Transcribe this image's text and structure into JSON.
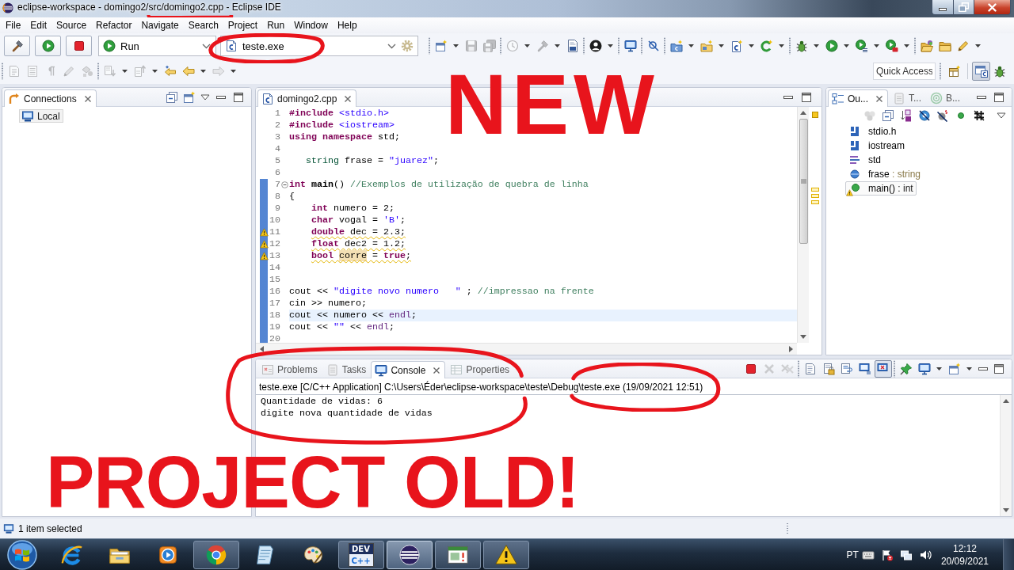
{
  "window": {
    "title": "eclipse-workspace - domingo2/src/domingo2.cpp - Eclipse IDE"
  },
  "menu": [
    "File",
    "Edit",
    "Source",
    "Refactor",
    "Navigate",
    "Search",
    "Project",
    "Run",
    "Window",
    "Help"
  ],
  "toolbar": {
    "launch_buttons": [
      {
        "kind": "build"
      },
      {
        "kind": "launch"
      },
      {
        "kind": "stop"
      }
    ],
    "launch_mode": {
      "value": "Run"
    },
    "launch_config": {
      "value": "teste.exe"
    },
    "items": [
      {
        "kind": "separator"
      },
      {
        "kind": "new",
        "disabled": false
      },
      {
        "kind": "dropdown"
      },
      {
        "kind": "save",
        "disabled": true
      },
      {
        "kind": "saveall",
        "disabled": true
      },
      {
        "kind": "separator"
      },
      {
        "kind": "clock",
        "disabled": true
      },
      {
        "kind": "dropdown"
      },
      {
        "kind": "hammer",
        "disabled": true
      },
      {
        "kind": "dropdown"
      },
      {
        "kind": "binary",
        "disabled": false
      },
      {
        "kind": "separator"
      },
      {
        "kind": "person",
        "disabled": false
      },
      {
        "kind": "dropdown"
      },
      {
        "kind": "separator"
      },
      {
        "kind": "monitor",
        "disabled": false
      },
      {
        "kind": "separator"
      },
      {
        "kind": "pin",
        "disabled": false
      },
      {
        "kind": "separator"
      },
      {
        "kind": "newproj",
        "disabled": false
      },
      {
        "kind": "dropdown"
      },
      {
        "kind": "newfolder",
        "disabled": false
      },
      {
        "kind": "dropdown"
      },
      {
        "kind": "newfile",
        "disabled": false
      },
      {
        "kind": "dropdown"
      },
      {
        "kind": "newclass",
        "disabled": false
      },
      {
        "kind": "dropdown"
      },
      {
        "kind": "separator"
      },
      {
        "kind": "bug",
        "disabled": false
      },
      {
        "kind": "dropdown"
      },
      {
        "kind": "play",
        "disabled": false
      },
      {
        "kind": "dropdown"
      },
      {
        "kind": "playlist",
        "disabled": false
      },
      {
        "kind": "dropdown"
      },
      {
        "kind": "playbox",
        "disabled": false
      },
      {
        "kind": "dropdown"
      },
      {
        "kind": "separator"
      },
      {
        "kind": "openfolder",
        "disabled": false
      },
      {
        "kind": "folder",
        "disabled": false
      },
      {
        "kind": "pen",
        "disabled": false
      },
      {
        "kind": "dropdown"
      }
    ]
  },
  "toolbar2": {
    "items": [
      {
        "kind": "separator"
      },
      {
        "kind": "toggle",
        "disabled": true
      },
      {
        "kind": "list",
        "disabled": true
      },
      {
        "kind": "pilcrow",
        "disabled": true
      },
      {
        "kind": "pen",
        "disabled": true
      },
      {
        "kind": "shapes",
        "disabled": true
      },
      {
        "kind": "separator"
      },
      {
        "kind": "nextann",
        "disabled": true
      },
      {
        "kind": "dropdown"
      },
      {
        "kind": "prevann",
        "disabled": true
      },
      {
        "kind": "dropdown"
      },
      {
        "kind": "lastedit",
        "disabled": false
      },
      {
        "kind": "back",
        "disabled": false
      },
      {
        "kind": "dropdown"
      },
      {
        "kind": "forward",
        "disabled": true
      },
      {
        "kind": "dropdown"
      }
    ],
    "quick_access": {
      "placeholder": "Quick Access"
    },
    "perspectives": [
      {
        "kind": "open",
        "selected": false
      },
      {
        "kind": "cpp",
        "selected": true
      },
      {
        "kind": "debug",
        "selected": false
      }
    ]
  },
  "connections": {
    "tab": {
      "label": "Connections"
    },
    "items": [
      {
        "label": "Local",
        "selected": true
      }
    ]
  },
  "editor": {
    "tab": {
      "label": "domingo2.cpp"
    },
    "sections": [
      {
        "in_range": false,
        "lines": [
          {
            "number": "1",
            "tokens": [
              {
                "text": "#include",
                "kind": "keyword"
              },
              {
                "text": " <stdio.h>",
                "kind": "string"
              }
            ],
            "warning": false,
            "current": false,
            "foldable": false
          },
          {
            "number": "2",
            "tokens": [
              {
                "text": "#include",
                "kind": "keyword"
              },
              {
                "text": " <iostream>",
                "kind": "string"
              }
            ],
            "warning": false,
            "current": false,
            "foldable": false
          },
          {
            "number": "3",
            "tokens": [
              {
                "text": "using",
                "kind": "keyword"
              },
              {
                "text": " namespace",
                "kind": "keyword"
              },
              {
                "text": " std;",
                "kind": "plain"
              }
            ],
            "warning": false,
            "current": false,
            "foldable": false
          },
          {
            "number": "4",
            "warning": false,
            "current": false,
            "foldable": false
          },
          {
            "number": "5",
            "tokens": [
              {
                "text": "   string",
                "kind": "type"
              },
              {
                "text": " frase = ",
                "kind": "plain"
              },
              {
                "text": "\"juarez\"",
                "kind": "string"
              },
              {
                "text": ";",
                "kind": "plain"
              }
            ],
            "warning": false,
            "current": false,
            "foldable": false
          },
          {
            "number": "6",
            "warning": false,
            "current": false,
            "foldable": false
          }
        ]
      },
      {
        "in_range": true,
        "lines": [
          {
            "number": "7",
            "tokens": [
              {
                "text": "int",
                "kind": "keyword"
              },
              {
                "text": " main",
                "kind": "function"
              },
              {
                "text": "() ",
                "kind": "plain"
              },
              {
                "text": "//Exemplos de utilização de quebra de linha",
                "kind": "comment"
              }
            ],
            "warning": false,
            "current": false,
            "foldable": true
          },
          {
            "number": "8",
            "tokens": [
              {
                "text": "{",
                "kind": "plain"
              }
            ],
            "warning": false,
            "current": false,
            "foldable": false
          },
          {
            "number": "9",
            "tokens": [
              {
                "text": "    int",
                "kind": "keyword"
              },
              {
                "text": " numero = 2;",
                "kind": "plain"
              }
            ],
            "warning": false,
            "current": false,
            "foldable": false
          },
          {
            "number": "10",
            "tokens": [
              {
                "text": "    char",
                "kind": "keyword"
              },
              {
                "text": " vogal = ",
                "kind": "plain"
              },
              {
                "text": "'B'",
                "kind": "string"
              },
              {
                "text": ";",
                "kind": "plain"
              }
            ],
            "warning": false,
            "current": false,
            "foldable": false
          },
          {
            "number": "11",
            "tokens": [
              {
                "text": "    double",
                "kind": "keyword"
              },
              {
                "text": " dec = 2.3;",
                "kind": "plain"
              }
            ],
            "warning": true,
            "current": false,
            "foldable": false
          },
          {
            "number": "12",
            "tokens": [
              {
                "text": "    float",
                "kind": "keyword"
              },
              {
                "text": " dec2 = 1.2;",
                "kind": "plain"
              }
            ],
            "warning": true,
            "current": false,
            "foldable": false
          },
          {
            "number": "13",
            "tokens": [
              {
                "text": "    bool ",
                "kind": "keyword"
              },
              {
                "text": "corre",
                "kind": "occurrence"
              },
              {
                "text": " = ",
                "kind": "plain"
              },
              {
                "text": "true",
                "kind": "keyword"
              },
              {
                "text": ";",
                "kind": "plain"
              }
            ],
            "warning": true,
            "current": false,
            "foldable": false
          },
          {
            "number": "14",
            "warning": false,
            "current": false,
            "foldable": false
          },
          {
            "number": "15",
            "warning": false,
            "current": false,
            "foldable": false
          },
          {
            "number": "16",
            "tokens": [
              {
                "text": "cout << ",
                "kind": "plain"
              },
              {
                "text": "\"digite novo numero   \"",
                "kind": "string"
              },
              {
                "text": " ; ",
                "kind": "plain"
              },
              {
                "text": "//impressao na frente",
                "kind": "comment"
              }
            ],
            "warning": false,
            "current": false,
            "foldable": false
          },
          {
            "number": "17",
            "tokens": [
              {
                "text": "cin >> numero;",
                "kind": "plain"
              }
            ],
            "warning": false,
            "current": false,
            "foldable": false
          },
          {
            "number": "18",
            "tokens": [
              {
                "text": "cout << numero << ",
                "kind": "plain"
              },
              {
                "text": "endl",
                "kind": "library"
              },
              {
                "text": ";",
                "kind": "plain"
              }
            ],
            "warning": false,
            "current": true,
            "foldable": false
          },
          {
            "number": "19",
            "tokens": [
              {
                "text": "cout << ",
                "kind": "plain"
              },
              {
                "text": "\"\"",
                "kind": "string"
              },
              {
                "text": " << ",
                "kind": "plain"
              },
              {
                "text": "endl",
                "kind": "library"
              },
              {
                "text": ";",
                "kind": "plain"
              }
            ],
            "warning": false,
            "current": false,
            "foldable": false
          },
          {
            "number": "20",
            "warning": false,
            "current": false,
            "foldable": false
          }
        ]
      }
    ]
  },
  "outline": {
    "tabs": [
      {
        "kind": "outline",
        "label": "Ou...",
        "selected": true
      },
      {
        "kind": "tasks",
        "label": "T...",
        "selected": false
      },
      {
        "kind": "targets",
        "label": "B...",
        "selected": false
      }
    ],
    "actions": [
      {
        "kind": "circles",
        "disabled": true
      },
      {
        "kind": "collapse",
        "disabled": false
      },
      {
        "kind": "sortaz",
        "disabled": false
      },
      {
        "kind": "hidefields",
        "disabled": false
      },
      {
        "kind": "hidestatic",
        "disabled": false
      },
      {
        "kind": "dot",
        "disabled": false
      },
      {
        "kind": "hash",
        "disabled": false
      }
    ],
    "items": [
      {
        "kind": "include",
        "label": "stdio.h",
        "selected": false,
        "warning": false
      },
      {
        "kind": "include",
        "label": "iostream",
        "selected": false,
        "warning": false
      },
      {
        "kind": "namespace",
        "label": "std",
        "selected": false,
        "warning": false
      },
      {
        "kind": "variable",
        "label": "frase",
        "type": ": string",
        "selected": false,
        "warning": false
      },
      {
        "kind": "function",
        "label": "main()",
        "type": ": int",
        "selected": true,
        "warning": true
      }
    ]
  },
  "console": {
    "tabs": [
      {
        "kind": "problems",
        "label": "Problems",
        "selected": false
      },
      {
        "kind": "tasks",
        "label": "Tasks",
        "selected": false
      },
      {
        "kind": "console",
        "label": "Console",
        "selected": true
      },
      {
        "kind": "properties",
        "label": "Properties",
        "selected": false
      }
    ],
    "actions": [
      {
        "kind": "stop",
        "disabled": false,
        "on": false
      },
      {
        "kind": "remove",
        "disabled": true,
        "on": false
      },
      {
        "kind": "removeall",
        "disabled": true,
        "on": false
      },
      {
        "kind": "separator"
      },
      {
        "kind": "clear",
        "disabled": false,
        "on": false
      },
      {
        "kind": "lock",
        "disabled": false,
        "on": false
      },
      {
        "kind": "wrap",
        "disabled": false,
        "on": false
      },
      {
        "kind": "stdout",
        "disabled": false,
        "on": false
      },
      {
        "kind": "stderr",
        "disabled": false,
        "on": true
      },
      {
        "kind": "separator"
      },
      {
        "kind": "pinconsole",
        "disabled": false,
        "on": false
      },
      {
        "kind": "monitor",
        "disabled": false,
        "on": false
      },
      {
        "kind": "dropdown"
      },
      {
        "kind": "new",
        "disabled": false,
        "on": false
      },
      {
        "kind": "dropdown"
      }
    ],
    "process": "teste.exe [C/C++ Application] C:\\Users\\Éder\\eclipse-workspace\\teste\\Debug\\teste.exe (19/09/2021 12:51)",
    "output": [
      "Quantidade de vidas: 6",
      "digite nova quantidade de vidas"
    ]
  },
  "status_bar": {
    "text": "1 item selected"
  },
  "taskbar": {
    "items": [
      {
        "kind": "ie",
        "running": false,
        "selected": false
      },
      {
        "kind": "explorer",
        "running": false,
        "selected": false
      },
      {
        "kind": "wmp",
        "running": false,
        "selected": false
      },
      {
        "kind": "chrome",
        "running": true,
        "selected": false
      },
      {
        "kind": "notes",
        "running": false,
        "selected": false
      },
      {
        "kind": "paint",
        "running": false,
        "selected": false
      },
      {
        "kind": "devcpp",
        "running": true,
        "selected": false,
        "logo": [
          "DEV",
          "C++"
        ]
      },
      {
        "kind": "eclipse",
        "running": true,
        "selected": true
      },
      {
        "kind": "appwin",
        "running": true,
        "selected": false
      },
      {
        "kind": "warning",
        "running": true,
        "selected": false
      }
    ],
    "tray": [
      {
        "kind": "keyboard"
      },
      {
        "kind": "flag"
      },
      {
        "kind": "network"
      },
      {
        "kind": "volume"
      }
    ],
    "language": "PT",
    "time": "12:12",
    "date": "20/09/2021"
  },
  "annotations": [
    {
      "kind": "text",
      "text": "NEW"
    },
    {
      "kind": "text",
      "text": "PROJECT OLD!"
    },
    {
      "kind": "bracket"
    },
    {
      "kind": "loop"
    },
    {
      "kind": "loop"
    },
    {
      "kind": "loop"
    }
  ]
}
